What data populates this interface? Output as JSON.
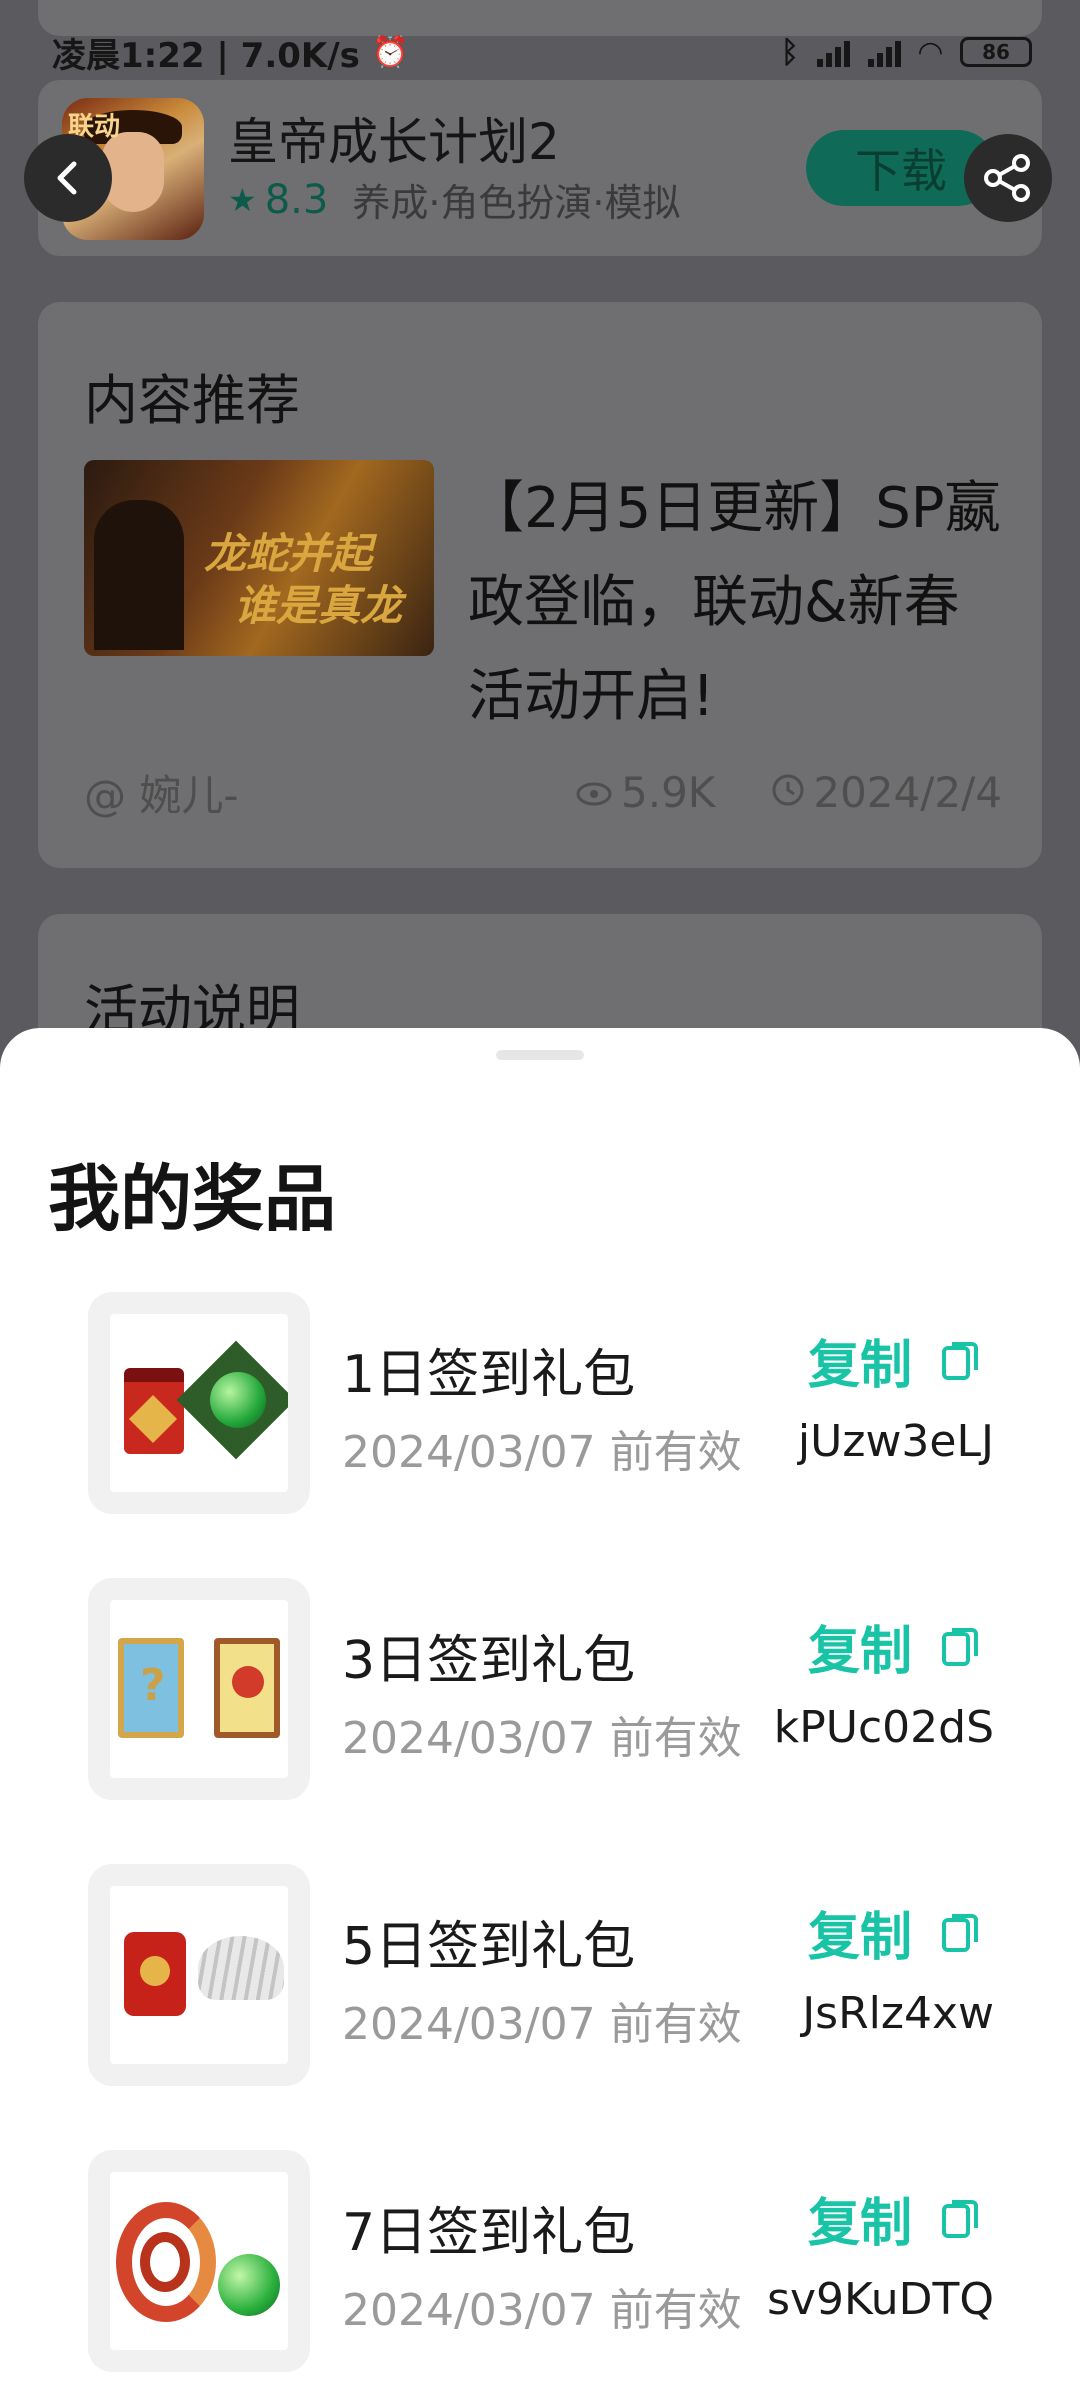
{
  "status_bar": {
    "left_text": "凌晨1:22 | 7.0K/s",
    "battery": "86"
  },
  "app": {
    "name": "皇帝成长计划2",
    "rating": "8.3",
    "tags": "养成·角色扮演·模拟",
    "download_label": "下载",
    "icon_badge": "联动"
  },
  "recommend": {
    "section_title": "内容推荐",
    "image_caption_1": "龙蛇并起",
    "image_caption_2": "谁是真龙",
    "article_title": "【2月5日更新】SP嬴政登临，联动&新春活动开启!",
    "author": "@ 婉儿-",
    "views": "5.9K",
    "date": "2024/2/4"
  },
  "activity": {
    "section_title": "活动说明"
  },
  "sheet": {
    "title": "我的奖品",
    "copy_label": "复制",
    "prizes": [
      {
        "name": "1日签到礼包",
        "valid": "2024/03/07 前有效",
        "code": "jUzw3eLJ"
      },
      {
        "name": "3日签到礼包",
        "valid": "2024/03/07 前有效",
        "code": "kPUc02dS"
      },
      {
        "name": "5日签到礼包",
        "valid": "2024/03/07 前有效",
        "code": "JsRlz4xw"
      },
      {
        "name": "7日签到礼包",
        "valid": "2024/03/07 前有效",
        "code": "sv9KuDTQ"
      }
    ]
  },
  "colors": {
    "accent": "#19c4a6",
    "scrim": "#5b5b5f",
    "sheet_bg": "#ffffff"
  },
  "icons": {
    "back": "chevron-left-icon",
    "share": "share-icon",
    "star": "star-icon",
    "eye": "eye-icon",
    "clock": "clock-icon",
    "copy": "copy-icon"
  }
}
